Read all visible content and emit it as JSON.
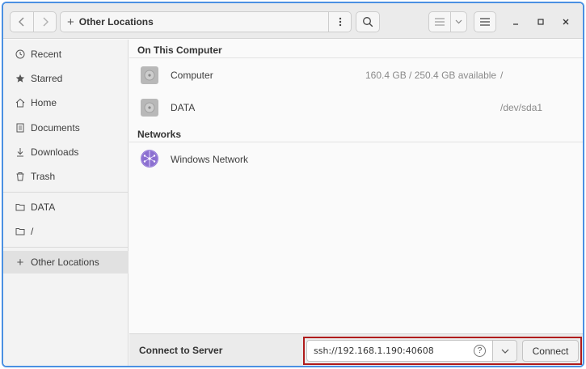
{
  "header": {
    "location_label": "Other Locations"
  },
  "sidebar": {
    "items": [
      {
        "label": "Recent",
        "icon": "clock-icon"
      },
      {
        "label": "Starred",
        "icon": "star-icon"
      },
      {
        "label": "Home",
        "icon": "home-icon"
      },
      {
        "label": "Documents",
        "icon": "document-icon"
      },
      {
        "label": "Downloads",
        "icon": "download-icon"
      },
      {
        "label": "Trash",
        "icon": "trash-icon"
      }
    ],
    "mounts": [
      {
        "label": "DATA",
        "icon": "folder-icon"
      },
      {
        "label": "/",
        "icon": "folder-icon"
      }
    ],
    "other_locations": {
      "label": "Other Locations",
      "icon": "plus-icon"
    }
  },
  "main": {
    "on_this_computer": {
      "title": "On This Computer",
      "rows": [
        {
          "name": "Computer",
          "usage": "160.4 GB / 250.4 GB available",
          "path": "/",
          "icon": "drive-icon"
        },
        {
          "name": "DATA",
          "usage": "",
          "path": "/dev/sda1",
          "icon": "drive-icon"
        }
      ]
    },
    "networks": {
      "title": "Networks",
      "rows": [
        {
          "name": "Windows Network",
          "icon": "network-icon"
        }
      ]
    }
  },
  "bottom": {
    "label": "Connect to Server",
    "server_address": "ssh://192.168.1.190:40608",
    "connect_label": "Connect"
  },
  "colors": {
    "accent_border": "#4a90e2",
    "highlight_box": "#b01c1c"
  }
}
